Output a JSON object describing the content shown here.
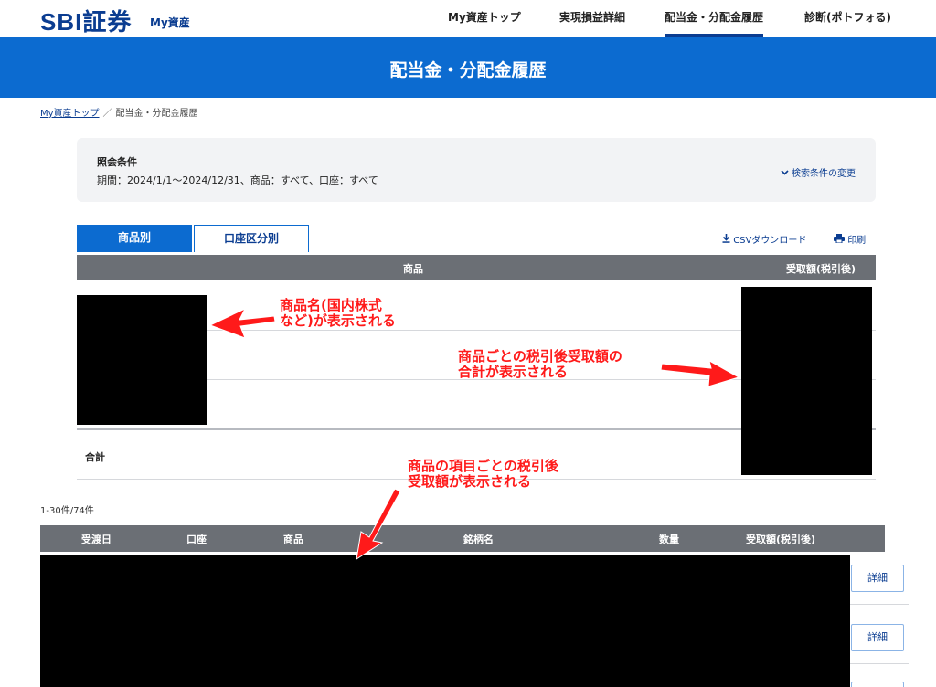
{
  "header": {
    "logo": "SBI証券",
    "logo_sub": "My資産",
    "nav": [
      {
        "label": "My資産トップ"
      },
      {
        "label": "実現損益詳細"
      },
      {
        "label": "配当金・分配金履歴"
      },
      {
        "label": "診断(ポトフォる)"
      }
    ]
  },
  "banner": {
    "title": "配当金・分配金履歴"
  },
  "breadcrumb": {
    "link": "My資産トップ",
    "separator": "／",
    "current": "配当金・分配金履歴"
  },
  "condition": {
    "title": "照会条件",
    "text": "期間：2024/1/1〜2024/12/31、商品：すべて、口座：すべて",
    "change": "検索条件の変更"
  },
  "tabs": [
    {
      "label": "商品別",
      "active": true
    },
    {
      "label": "口座区分別",
      "active": false
    }
  ],
  "tools": {
    "csv": "CSVダウンロード",
    "print": "印刷"
  },
  "summary_table": {
    "columns": [
      "商品",
      "受取額(税引後)"
    ],
    "total_label": "合計"
  },
  "pager": "1-30件/74件",
  "detail_table": {
    "columns": [
      "受渡日",
      "口座",
      "商品",
      "銘柄名",
      "数量",
      "受取額(税引後)"
    ],
    "detail_button": "詳細"
  },
  "annotations": {
    "a1_line1": "商品名(国内株式",
    "a1_line2": "など)が表示される",
    "a2_line1": "商品ごとの税引後受取額の",
    "a2_line2": "合計が表示される",
    "a3_line1": "商品の項目ごとの税引後",
    "a3_line2": "受取額が表示される",
    "color": "#ff1a1a"
  },
  "colors": {
    "brand_blue": "#0c6bd0",
    "navy": "#0b3d91",
    "header_gray": "#6b6f75"
  }
}
